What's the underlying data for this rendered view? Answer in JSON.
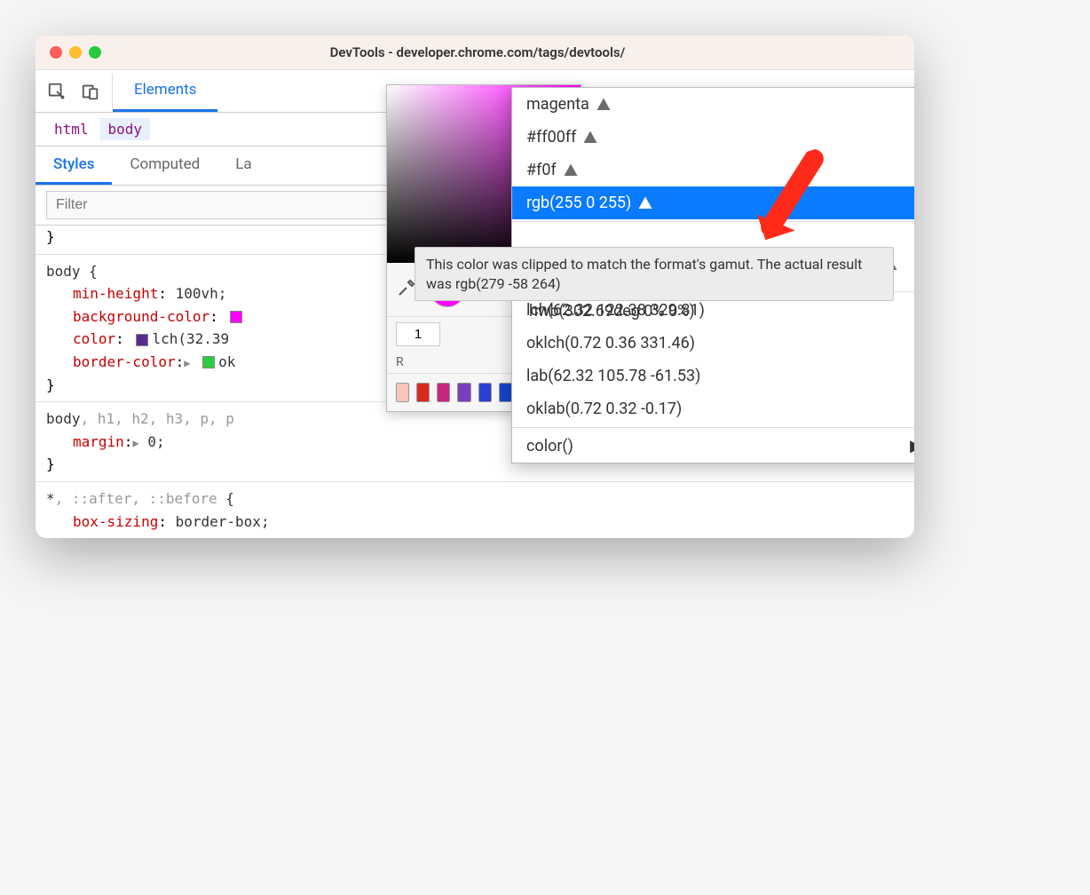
{
  "window": {
    "title": "DevTools - developer.chrome.com/tags/devtools/"
  },
  "toolbar": {
    "tabs": {
      "elements": "Elements"
    }
  },
  "breadcrumb": {
    "items": [
      "html",
      "body"
    ]
  },
  "subtabs": {
    "styles": "Styles",
    "computed": "Computed",
    "layout": "La"
  },
  "filter": {
    "placeholder": "Filter"
  },
  "styles": {
    "closing_brace_top": "}",
    "rule_body": {
      "selector": "body {",
      "props": {
        "min_height": {
          "name": "min-height",
          "value": "100vh;"
        },
        "background_color": {
          "name": "background-color",
          "suffix": ":"
        },
        "color": {
          "name": "color",
          "value": "lch(32.39 "
        },
        "border_color": {
          "name": "border-color",
          "value": "ok"
        }
      },
      "close": "}"
    },
    "rule_margin": {
      "selector_main": "body",
      "selector_dim": ", h1, h2, h3, p, p",
      "prop": {
        "name": "margin",
        "value": "0;"
      },
      "close": "}"
    },
    "rule_box": {
      "selector_main": "*",
      "selector_dim": ", ::after, ::before",
      "open": " {",
      "prop": {
        "name": "box-sizing",
        "value": "border-box;"
      }
    }
  },
  "picker": {
    "alpha": "1",
    "channel_label": "R",
    "swatches": [
      "#f7c6bd",
      "#d82a1f",
      "#c7277e",
      "#7a3fbd",
      "#2c3ed6",
      "#1446c9",
      "#2a72e0",
      "#3b8de6"
    ]
  },
  "format_menu": {
    "items_warn": [
      "magenta",
      "#ff00ff",
      "#f0f",
      "rgb(255 0 255)"
    ],
    "overflow_partial": "%)",
    "hwb_partial": "hwb(302.69deg 0% 0%)",
    "items_plain": [
      "lch(62.32 122.38 329.81)",
      "oklch(0.72 0.36 331.46)",
      "lab(62.32 105.78 -61.53)",
      "oklab(0.72 0.32 -0.17)"
    ],
    "more": "color()"
  },
  "tooltip": {
    "text": "This color was clipped to match the format's gamut. The actual result was rgb(279 -58 264)"
  }
}
